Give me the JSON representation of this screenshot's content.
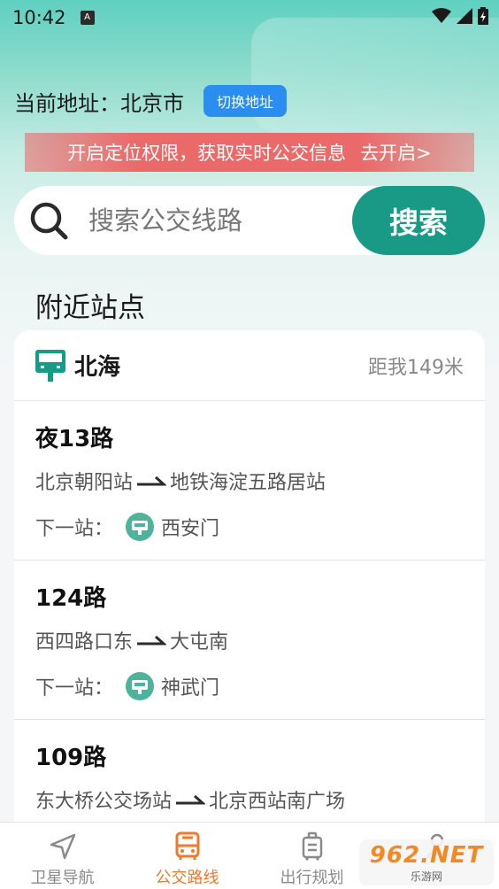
{
  "status_bar": {
    "time": "10:42",
    "app_icon_letter": "A"
  },
  "header": {
    "address_text": "当前地址：北京市",
    "switch_label": "切换地址"
  },
  "banner": {
    "text": "开启定位权限，获取实时公交信息",
    "action": "去开启>"
  },
  "search": {
    "placeholder": "搜索公交线路",
    "button_label": "搜索"
  },
  "nearby": {
    "title": "附近站点",
    "stop_name": "北海",
    "distance": "距我149米",
    "next_label": "下一站：",
    "routes": [
      {
        "name": "夜13路",
        "from": "北京朝阳站",
        "to": "地铁海淀五路居站",
        "next": "西安门"
      },
      {
        "name": "124路",
        "from": "西四路口东",
        "to": "大屯南",
        "next": "神武门"
      },
      {
        "name": "109路",
        "from": "东大桥公交场站",
        "to": "北京西站南广场",
        "next": ""
      }
    ]
  },
  "tabs": [
    {
      "label": "卫星导航",
      "icon": "navigation-arrow-icon",
      "active": false
    },
    {
      "label": "公交路线",
      "icon": "bus-icon",
      "active": true
    },
    {
      "label": "出行规划",
      "icon": "luggage-icon",
      "active": false
    },
    {
      "label": "",
      "icon": "person-icon",
      "active": false
    }
  ],
  "watermark": {
    "main": "962.NET",
    "sub": "乐游网"
  },
  "colors": {
    "accent_teal": "#199a86",
    "active_tab": "#f07a2a",
    "switch_blue": "#2a8df0",
    "banner_red": "#ea6a6a"
  }
}
